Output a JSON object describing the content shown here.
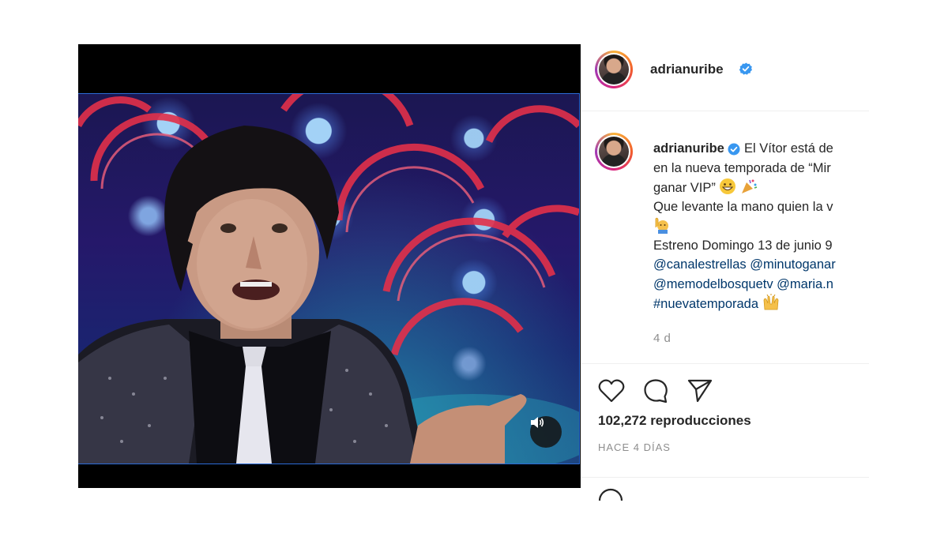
{
  "post": {
    "username": "adrianuribe",
    "verified": true,
    "caption_lines": [
      "El Vítor está de",
      "en la nueva temporada de “Mir",
      "ganar VIP”",
      "Que levante la mano quien la v",
      "Estreno Domingo 13 de junio 9"
    ],
    "mentions_line1": [
      "@canalestrellas",
      "@minutoganar"
    ],
    "mentions_line2": [
      "@memodelbosquetv",
      "@maria.n"
    ],
    "hashtag": "#nuevatemporada",
    "time_ago": "4 d",
    "views_count": "102,272",
    "views_label": "reproducciones",
    "timestamp": "HACE 4 DÍAS"
  },
  "icons": {
    "like": "heart-icon",
    "comment": "comment-icon",
    "share": "send-icon",
    "sound": "speaker-icon",
    "verified": "verified-badge-icon"
  },
  "colors": {
    "verified_blue": "#3897f0",
    "link": "#00376b",
    "muted": "#8e8e8e",
    "divider": "#efefef"
  }
}
